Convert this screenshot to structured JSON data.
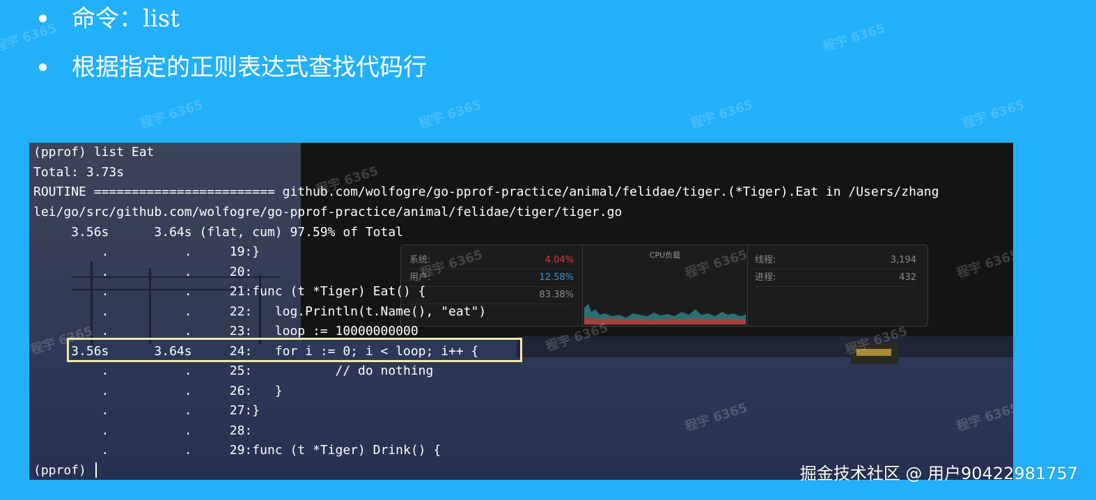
{
  "slide": {
    "bullets": [
      {
        "prefix": "命令：",
        "command": "list"
      },
      {
        "text": "根据指定的正则表达式查找代码行"
      }
    ]
  },
  "terminal": {
    "lines": [
      "(pprof) list Eat",
      "Total: 3.73s",
      "ROUTINE ======================== github.com/wolfogre/go-pprof-practice/animal/felidae/tiger.(*Tiger).Eat in /Users/zhang",
      "lei/go/src/github.com/wolfogre/go-pprof-practice/animal/felidae/tiger/tiger.go",
      "     3.56s      3.64s (flat, cum) 97.59% of Total",
      "         .          .     19:}",
      "         .          .     20:",
      "         .          .     21:func (t *Tiger) Eat() {",
      "         .          .     22:   log.Println(t.Name(), \"eat\")",
      "         .          .     23:   loop := 10000000000",
      "     3.56s      3.64s     24:   for i := 0; i < loop; i++ {",
      "         .          .     25:           // do nothing",
      "         .          .     26:   }",
      "         .          .     27:}",
      "         .          .     28:",
      "         .          .     29:func (t *Tiger) Drink() {"
    ],
    "prompt": "(pprof) ",
    "highlighted_line": 24
  },
  "background_monitor": {
    "left": [
      {
        "label": "系统:",
        "value": "4.04%",
        "color": "#d0413f"
      },
      {
        "label": "用户:",
        "value": "12.58%",
        "color": "#3f8ed0"
      },
      {
        "label": "",
        "value": "83.38%",
        "color": "#8a8a8a"
      }
    ],
    "title": "CPU负载",
    "right": [
      {
        "label": "线程:",
        "value": "3,194"
      },
      {
        "label": "进程:",
        "value": "432"
      }
    ]
  },
  "watermark_text": "程宇 6365",
  "credit": "掘金技术社区 @ 用户90422981757"
}
